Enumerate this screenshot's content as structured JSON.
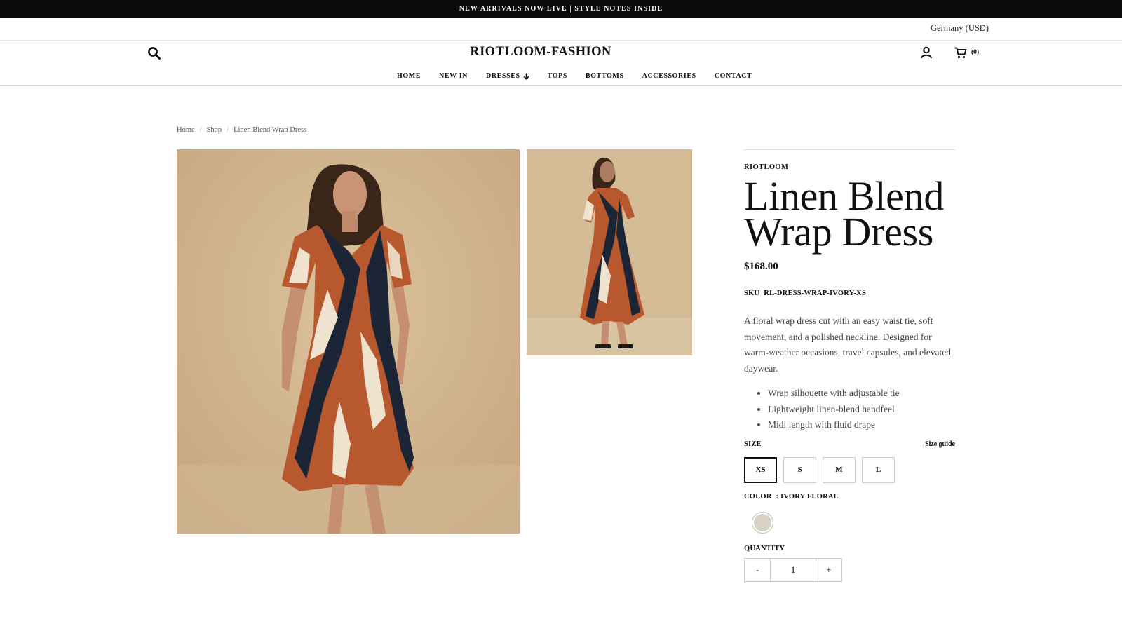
{
  "announcement": "NEW ARRIVALS NOW LIVE | STYLE NOTES INSIDE",
  "locale": "Germany (USD)",
  "logo": "RIOTLOOM-FASHION",
  "cart": {
    "count": "(0)"
  },
  "nav": {
    "home": "HOME",
    "new_in": "NEW IN",
    "dresses": "DRESSES",
    "tops": "TOPS",
    "bottoms": "BOTTOMS",
    "accessories": "ACCESSORIES",
    "contact": "CONTACT"
  },
  "breadcrumb": {
    "home": "Home",
    "shop": "Shop",
    "current": "Linen Blend Wrap Dress",
    "separator": "/"
  },
  "product": {
    "brand": "RIOTLOOM",
    "title": "Linen Blend Wrap Dress",
    "price": "$168.00",
    "sku_label": "SKU",
    "sku": "RL-DRESS-WRAP-IVORY-XS",
    "description": "A floral wrap dress cut with an easy waist tie, soft movement, and a polished neckline. Designed for warm-weather occasions, travel capsules, and elevated daywear.",
    "features": [
      "Wrap silhouette with adjustable tie",
      "Lightweight linen-blend handfeel",
      "Midi length with fluid drape"
    ],
    "size_label": "SIZE",
    "size_guide": "Size guide",
    "sizes": [
      "XS",
      "S",
      "M",
      "L"
    ],
    "selected_size": "XS",
    "color_label": "COLOR",
    "color_value": ": IVORY FLORAL",
    "swatch_color": "#d9d2c4",
    "quantity_label": "QUANTITY",
    "qty_minus": "-",
    "quantity": "1",
    "qty_plus": "+"
  },
  "icons": {
    "search": "search-icon",
    "account": "user-icon",
    "cart": "cart-icon",
    "dropdown": "arrow-down-icon"
  }
}
